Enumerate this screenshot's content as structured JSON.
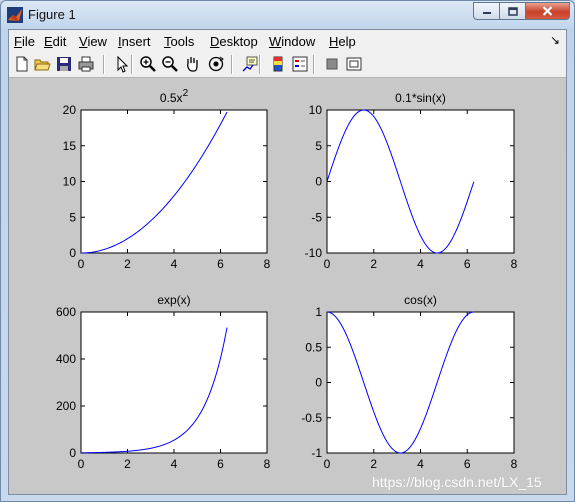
{
  "window": {
    "title": "Figure 1"
  },
  "menu": [
    {
      "label": "File",
      "key": "F",
      "rest": "ile"
    },
    {
      "label": "Edit",
      "key": "E",
      "rest": "dit"
    },
    {
      "label": "View",
      "key": "V",
      "rest": "iew"
    },
    {
      "label": "Insert",
      "key": "I",
      "rest": "nsert"
    },
    {
      "label": "Tools",
      "key": "T",
      "rest": "ools"
    },
    {
      "label": "Desktop",
      "key": "D",
      "rest": "esktop"
    },
    {
      "label": "Window",
      "key": "W",
      "rest": "indow"
    },
    {
      "label": "Help",
      "key": "H",
      "rest": "elp"
    }
  ],
  "toolbar_icons": [
    "new-figure-icon",
    "open-folder-icon",
    "save-icon",
    "print-icon",
    "edit-plot-arrow-icon",
    "zoom-in-icon",
    "zoom-out-icon",
    "pan-hand-icon",
    "rotate-3d-icon",
    "data-cursor-icon",
    "colorbar-icon",
    "legend-icon",
    "hide-plot-tools-icon",
    "show-plot-tools-icon"
  ],
  "watermark": "https://blog.csdn.net/LX_15",
  "chart_data": [
    {
      "type": "line",
      "title": "0.5x",
      "title_superscript": "2",
      "xlim": [
        0,
        8
      ],
      "ylim": [
        0,
        20
      ],
      "xticks": [
        "0",
        "2",
        "4",
        "6",
        "8"
      ],
      "yticks": [
        "0",
        "5",
        "10",
        "15",
        "20"
      ],
      "function": "0.5*x^2",
      "x_range": [
        0,
        6.28
      ],
      "points": [
        [
          0,
          0
        ],
        [
          1,
          0.5
        ],
        [
          2,
          2
        ],
        [
          3,
          4.5
        ],
        [
          4,
          8
        ],
        [
          5,
          12.5
        ],
        [
          6,
          18
        ],
        [
          6.28,
          19.72
        ]
      ],
      "color": "#0000ff"
    },
    {
      "type": "line",
      "title": "0.1*sin(x)",
      "xlim": [
        0,
        8
      ],
      "ylim": [
        -10,
        10
      ],
      "xticks": [
        "0",
        "2",
        "4",
        "6",
        "8"
      ],
      "yticks": [
        "-10",
        "-5",
        "0",
        "5",
        "10"
      ],
      "function": "10*sin(x)",
      "x_range": [
        0,
        6.28
      ],
      "points": [
        [
          0,
          0
        ],
        [
          1.57,
          10
        ],
        [
          3.14,
          0
        ],
        [
          4.71,
          -10
        ],
        [
          6.28,
          0
        ]
      ],
      "color": "#0000ff"
    },
    {
      "type": "line",
      "title": "exp(x)",
      "xlim": [
        0,
        8
      ],
      "ylim": [
        0,
        600
      ],
      "xticks": [
        "0",
        "2",
        "4",
        "6",
        "8"
      ],
      "yticks": [
        "0",
        "200",
        "400",
        "600"
      ],
      "function": "exp(x)",
      "x_range": [
        0,
        6.28
      ],
      "points": [
        [
          0,
          1
        ],
        [
          2,
          7.39
        ],
        [
          3,
          20.09
        ],
        [
          4,
          54.6
        ],
        [
          5,
          148.4
        ],
        [
          6,
          403.4
        ],
        [
          6.28,
          533.5
        ]
      ],
      "color": "#0000ff"
    },
    {
      "type": "line",
      "title": "cos(x)",
      "xlim": [
        0,
        8
      ],
      "ylim": [
        -1,
        1
      ],
      "xticks": [
        "0",
        "2",
        "4",
        "6",
        "8"
      ],
      "yticks": [
        "-1",
        "-0.5",
        "0",
        "0.5",
        "1"
      ],
      "function": "cos(x)",
      "x_range": [
        0,
        6.28
      ],
      "points": [
        [
          0,
          1
        ],
        [
          1.57,
          0
        ],
        [
          3.14,
          -1
        ],
        [
          4.71,
          0
        ],
        [
          6.28,
          1
        ]
      ],
      "color": "#0000ff"
    }
  ]
}
